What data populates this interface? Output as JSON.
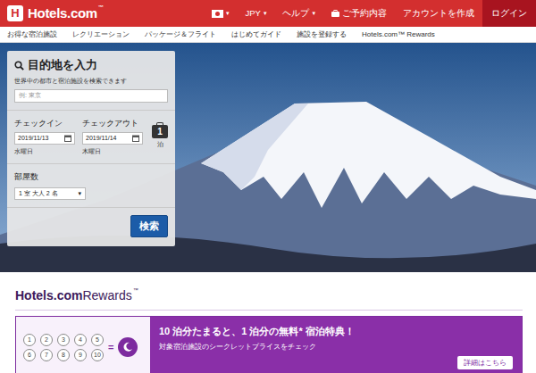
{
  "header": {
    "logo_mark": "H",
    "logo": "Hotels.com",
    "logo_tm": "™",
    "items": [
      {
        "kind": "flag",
        "caret": "▾"
      },
      {
        "kind": "dropdown",
        "label": "JPY",
        "caret": "▾"
      },
      {
        "kind": "dropdown",
        "label": "ヘルプ",
        "caret": "▾"
      },
      {
        "kind": "icon-link",
        "label": "ご予約内容"
      },
      {
        "kind": "link",
        "label": "アカウントを作成"
      },
      {
        "kind": "button",
        "label": "ログイン"
      }
    ]
  },
  "subnav": [
    "お得な宿泊施設",
    "レクリエーション",
    "パッケージ＆フライト",
    "はじめてガイド",
    "施設を登録する",
    "Hotels.com™ Rewards"
  ],
  "search": {
    "title": "目的地を入力",
    "subtitle": "世界中の都市と宿泊施設を検索できます",
    "placeholder": "例: 東京",
    "checkin": {
      "label": "チェックイン",
      "value": "2019/11/13",
      "weekday": "水曜日"
    },
    "checkout": {
      "label": "チェックアウト",
      "value": "2019/11/14",
      "weekday": "木曜日"
    },
    "nights": {
      "count": "1",
      "unit": "泊"
    },
    "rooms": {
      "label": "部屋数",
      "value": "1 室 大人 2 名",
      "caret": "▾"
    },
    "button": "検索"
  },
  "rewards": {
    "logo": "Hotels.com",
    "logo_suffix": "Rewards",
    "logo_tm": "™",
    "stamps": [
      "1",
      "2",
      "3",
      "4",
      "5",
      "6",
      "7",
      "8",
      "9",
      "10"
    ],
    "equals": "=",
    "headline": "10 泊分たまると、1 泊分の無料* 宿泊特典！",
    "subline": "対象宿泊施設のシークレットプライスをチェック",
    "button": "詳細はこちら"
  }
}
